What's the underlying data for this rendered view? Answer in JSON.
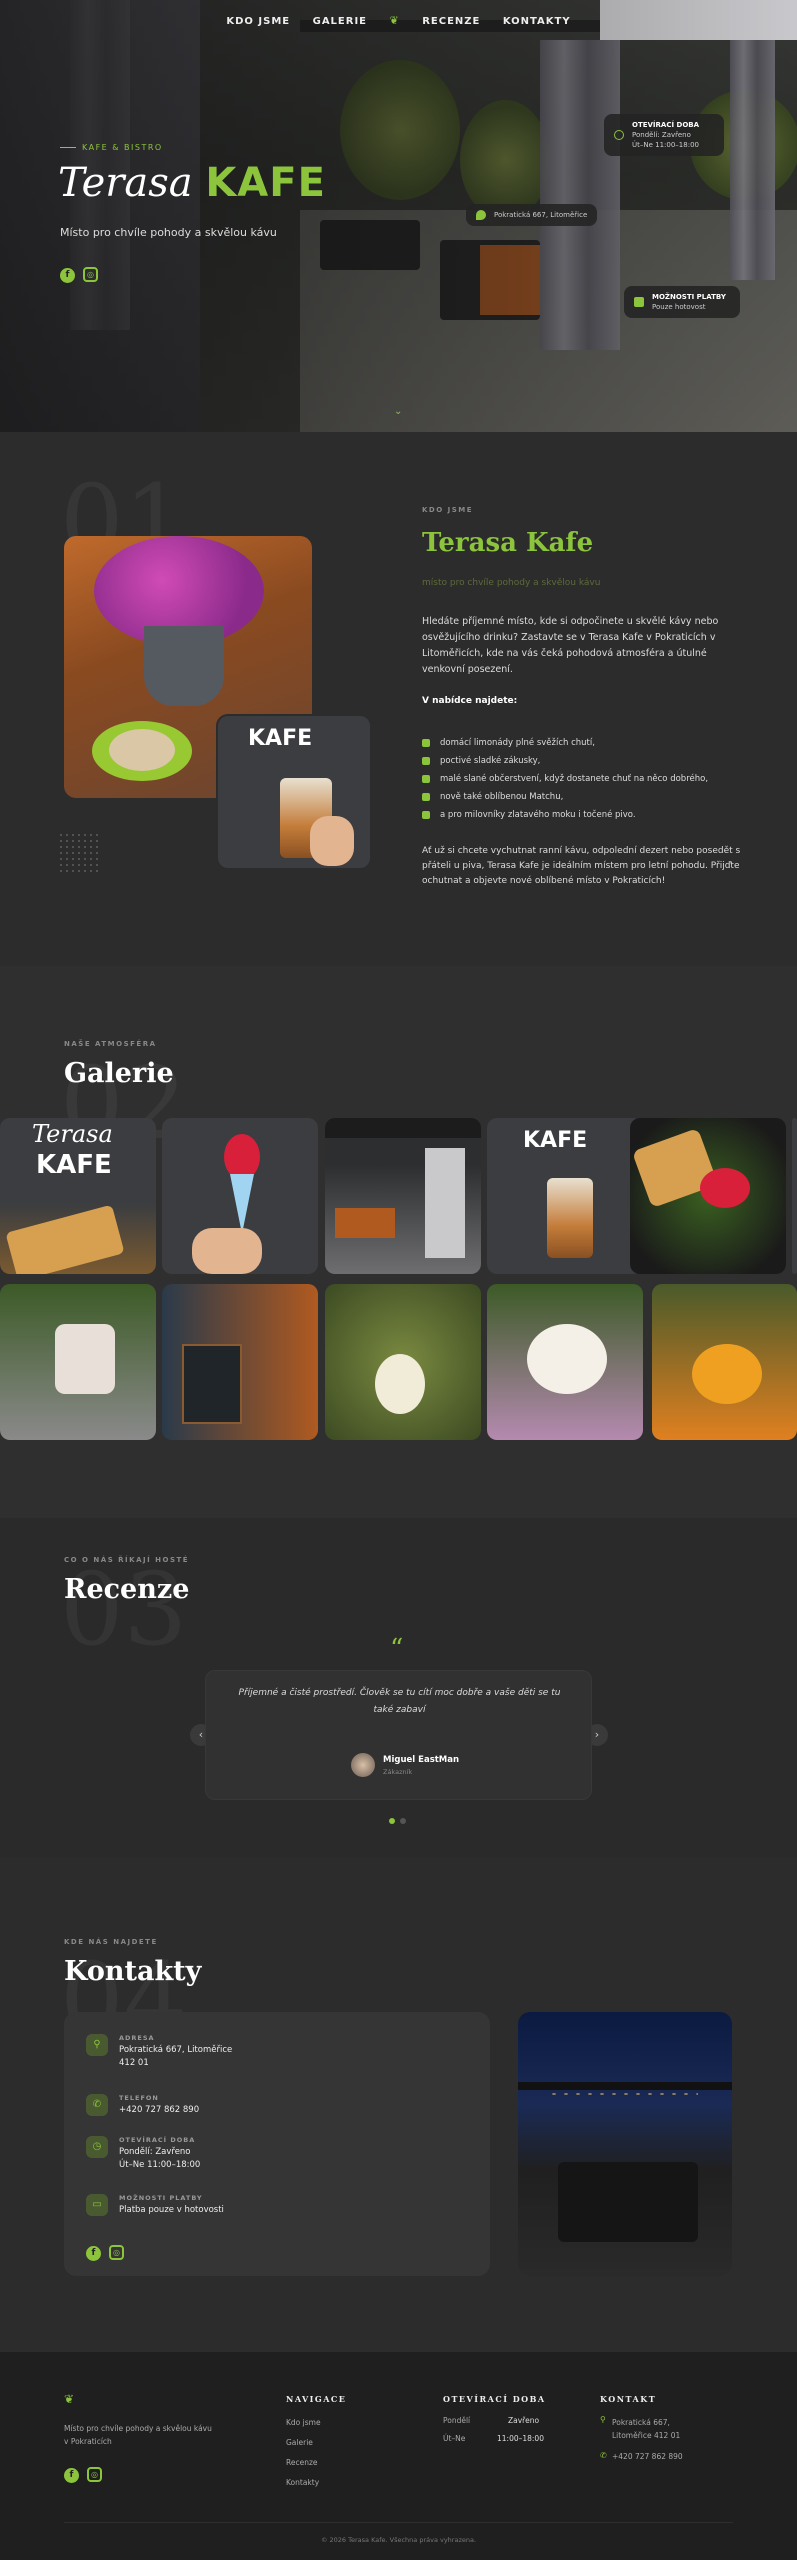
{
  "nav": {
    "items": [
      "KDO JSME",
      "GALERIE",
      "RECENZE",
      "KONTAKTY"
    ]
  },
  "hero": {
    "eyebrow": "KAFE & BISTRO",
    "title_script": "Terasa",
    "title_bold": "KAFE",
    "subtitle": "Místo pro chvíle pohody a skvělou kávu",
    "pill_hours": {
      "title": "OTEVÍRACÍ DOBA",
      "line1": "Pondělí: Zavřeno",
      "line2": "Út–Ne      11:00–18:00"
    },
    "pill_address": {
      "text": "Pokratická 667, Litoměřice"
    },
    "pill_payment": {
      "title": "MOŽNOSTI PLATBY",
      "line1": "Pouze hotovost"
    }
  },
  "about": {
    "number": "01",
    "eyebrow": "KDO JSME",
    "title": "Terasa Kafe",
    "tagline": "místo pro chvíle pohody a skvělou kávu",
    "intro": "Hledáte příjemné místo, kde si odpočinete u skvělé kávy nebo osvěžujícího drinku? Zastavte se v Terasa Kafe v Pokraticích v Litoměřicích, kde na vás čeká pohodová atmosféra a útulné venkovní posezení.",
    "list_title": "V nabídce najdete:",
    "list": [
      "domácí limonády plné svěžích chutí,",
      "poctivé sladké zákusky,",
      "malé slané občerstvení, když dostanete chuť na něco dobrého,",
      "nově také oblíbenou Matchu,",
      "a pro milovníky zlatavého moku i točené pivo."
    ],
    "outro": "Ať už si chcete vychutnat ranní kávu, odpolední dezert nebo posedět s přáteli u piva, Terasa Kafe je ideálním místem pro letní pohodu. Přijďte ochutnat a objevte nové oblíbené místo v Pokraticích!",
    "cup_sign": "KAFE"
  },
  "gallery": {
    "number": "02",
    "eyebrow": "NAŠE ATMOSFÉRA",
    "title": "Galerie",
    "sign_script": "Terasa",
    "sign_bold": "KAFE"
  },
  "reviews": {
    "number": "03",
    "eyebrow": "CO O NÁS ŘÍKAJÍ HOSTÉ",
    "title": "Recenze",
    "quote_mark": "“",
    "text": "Příjemné a čisté prostředí. Člověk se tu cítí moc dobře a vaše děti se tu také zabaví",
    "author": "Miguel EastMan",
    "role": "Zákazník",
    "prev": "‹",
    "next": "›"
  },
  "contact": {
    "number": "04",
    "eyebrow": "KDE NÁS NAJDETE",
    "title": "Kontakty",
    "rows": [
      {
        "label": "ADRESA",
        "value1": "Pokratická 667, Litoměřice",
        "value2": "412 01"
      },
      {
        "label": "TELEFON",
        "value1": "+420 727 862 890",
        "value2": ""
      },
      {
        "label": "OTEVÍRACÍ DOBA",
        "value1": "Pondělí: Zavřeno",
        "value2": "Út–Ne     11:00–18:00"
      },
      {
        "label": "MOŽNOSTI PLATBY",
        "value1": "Platba pouze v hotovosti",
        "value2": ""
      }
    ]
  },
  "footer": {
    "tagline": "Místo pro chvíle pohody a skvělou kávu v Pokraticích",
    "nav_title": "NAVIGACE",
    "nav": [
      "Kdo jsme",
      "Galerie",
      "Recenze",
      "Kontakty"
    ],
    "hours_title": "OTEVÍRACÍ DOBA",
    "hours": [
      [
        "Pondělí",
        "Zavřeno"
      ],
      [
        "Út–Ne",
        "11:00–18:00"
      ]
    ],
    "contact_title": "KONTAKT",
    "address": "Pokratická 667, Litoměřice 412 01",
    "phone": "+420 727 862 890",
    "copyright": "© 2026 Terasa Kafe. Všechna práva vyhrazena."
  },
  "colors": {
    "accent": "#8cc43c",
    "bg": "#2a2a2a",
    "footer": "#1f1f1f"
  }
}
